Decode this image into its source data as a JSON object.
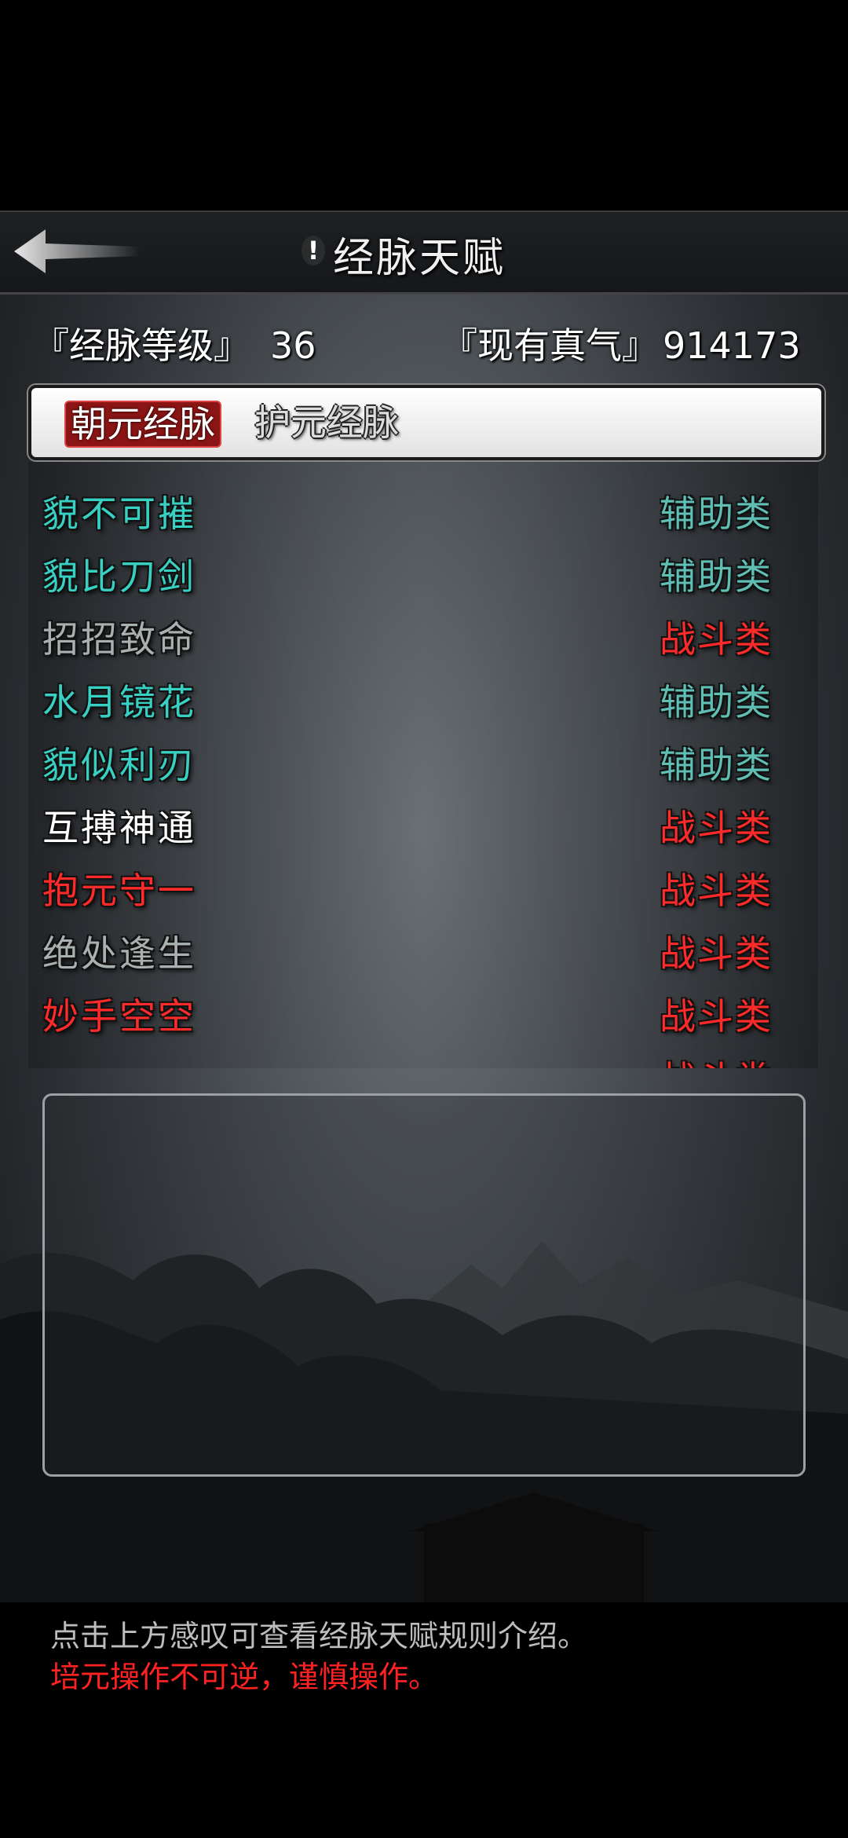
{
  "header": {
    "title": "经脉天赋",
    "info_mark": "!"
  },
  "stats": {
    "level_label": "『经脉等级』",
    "level_value": "36",
    "qi_label": "『现有真气』",
    "qi_value": "914173"
  },
  "tabs": [
    {
      "label": "朝元经脉",
      "active": true
    },
    {
      "label": "护元经脉",
      "active": false
    }
  ],
  "talents": [
    {
      "name": "貌不可摧",
      "category": "辅助类",
      "name_color": "#39d0c4",
      "cat_color": "#5fbfb5"
    },
    {
      "name": "貌比刀剑",
      "category": "辅助类",
      "name_color": "#39d0c4",
      "cat_color": "#5fbfb5"
    },
    {
      "name": "招招致命",
      "category": "战斗类",
      "name_color": "#a9b0b0",
      "cat_color": "#ff2a2a"
    },
    {
      "name": "水月镜花",
      "category": "辅助类",
      "name_color": "#39d0c4",
      "cat_color": "#5fbfb5"
    },
    {
      "name": "貌似利刃",
      "category": "辅助类",
      "name_color": "#39d0c4",
      "cat_color": "#5fbfb5"
    },
    {
      "name": "互搏神通",
      "category": "战斗类",
      "name_color": "#ffffff",
      "cat_color": "#ff2a2a"
    },
    {
      "name": "抱元守一",
      "category": "战斗类",
      "name_color": "#ff2a2a",
      "cat_color": "#ff2a2a"
    },
    {
      "name": "绝处逢生",
      "category": "战斗类",
      "name_color": "#a9b0b0",
      "cat_color": "#ff2a2a"
    },
    {
      "name": "妙手空空",
      "category": "战斗类",
      "name_color": "#ff2a2a",
      "cat_color": "#ff2a2a"
    },
    {
      "name": "…",
      "category": "战斗类",
      "name_color": "#ff2a2a",
      "cat_color": "#ff2a2a"
    }
  ],
  "footer": {
    "hint": "点击上方感叹可查看经脉天赋规则介绍。",
    "warning": "培元操作不可逆，谨慎操作。"
  }
}
